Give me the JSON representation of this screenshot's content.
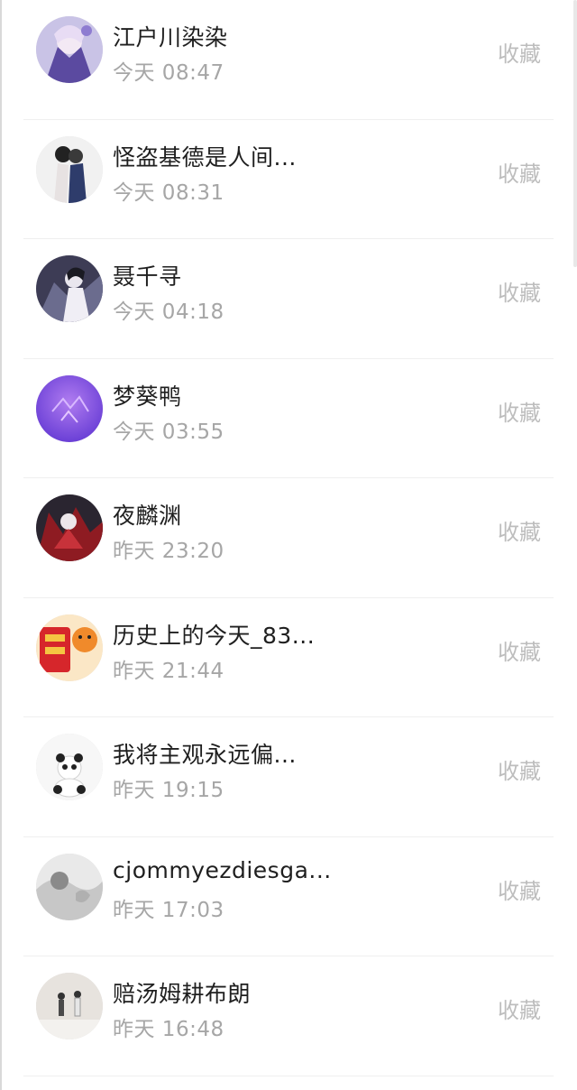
{
  "items": [
    {
      "name": "江户川染染",
      "time": "今天 08:47",
      "action": "收藏",
      "avatar_icon": "avatar-anime-purple"
    },
    {
      "name": "怪盗基德是人间...",
      "time": "今天 08:31",
      "action": "收藏",
      "avatar_icon": "avatar-anime-couple"
    },
    {
      "name": "聂千寻",
      "time": "今天 04:18",
      "action": "收藏",
      "avatar_icon": "avatar-anime-dark"
    },
    {
      "name": "梦葵鸭",
      "time": "今天 03:55",
      "action": "收藏",
      "avatar_icon": "avatar-violet"
    },
    {
      "name": "夜麟渊",
      "time": "昨天 23:20",
      "action": "收藏",
      "avatar_icon": "avatar-anime-red"
    },
    {
      "name": "历史上的今天_83...",
      "time": "昨天 21:44",
      "action": "收藏",
      "avatar_icon": "avatar-red-tiger"
    },
    {
      "name": "我将主观永远偏...",
      "time": "昨天 19:15",
      "action": "收藏",
      "avatar_icon": "avatar-panda"
    },
    {
      "name": "cjommyezdiesga...",
      "time": "昨天 17:03",
      "action": "收藏",
      "avatar_icon": "avatar-grey-bw"
    },
    {
      "name": "赔汤姆耕布朗",
      "time": "昨天 16:48",
      "action": "收藏",
      "avatar_icon": "avatar-couple-snow"
    }
  ],
  "colors": {
    "name_text": "#1f1f1f",
    "time_text": "#a6a6a6",
    "action_text": "#bdbdbd",
    "divider": "#efefef"
  }
}
